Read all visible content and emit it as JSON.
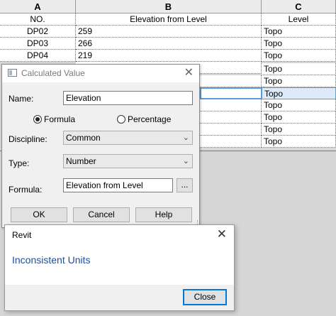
{
  "schedule": {
    "columns": [
      "A",
      "B",
      "C"
    ],
    "headers": [
      "NO.",
      "Elevation from Level",
      "Level"
    ],
    "rows": [
      {
        "no": "DP02",
        "elevation": "259",
        "level": "Topo"
      },
      {
        "no": "DP03",
        "elevation": "266",
        "level": "Topo"
      },
      {
        "no": "DP04",
        "elevation": "219",
        "level": "Topo"
      },
      {
        "no": "",
        "elevation": "",
        "level": "Topo"
      },
      {
        "no": "",
        "elevation": "",
        "level": "Topo"
      },
      {
        "no": "",
        "elevation": "",
        "level": "Topo"
      },
      {
        "no": "",
        "elevation": "",
        "level": "Topo"
      },
      {
        "no": "",
        "elevation": "",
        "level": "Topo"
      },
      {
        "no": "",
        "elevation": "",
        "level": "Topo"
      },
      {
        "no": "",
        "elevation": "",
        "level": "Topo"
      }
    ]
  },
  "calc_dialog": {
    "title": "Calculated Value",
    "name_label": "Name:",
    "name_value": "Elevation",
    "radio_formula": "Formula",
    "radio_percentage": "Percentage",
    "discipline_label": "Discipline:",
    "discipline_value": "Common",
    "type_label": "Type:",
    "type_value": "Number",
    "formula_label": "Formula:",
    "formula_value": "Elevation from Level",
    "ellipsis": "...",
    "ok": "OK",
    "cancel": "Cancel",
    "help": "Help",
    "close_glyph": "✕"
  },
  "message": {
    "title": "Revit",
    "text": "Inconsistent Units",
    "close_button": "Close",
    "close_glyph": "✕"
  }
}
